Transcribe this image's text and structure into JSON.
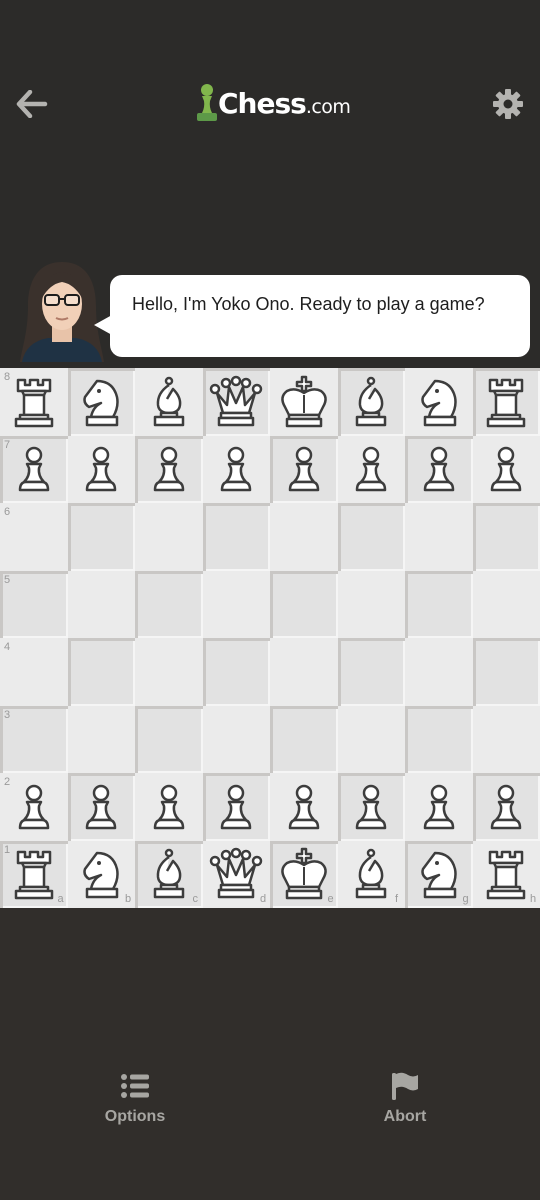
{
  "header": {
    "logo_text": "Chess",
    "logo_suffix": ".com",
    "back_icon": "arrow-left-icon",
    "settings_icon": "gear-icon"
  },
  "chat": {
    "message": "Hello, I'm Yoko Ono. Ready to play a game?"
  },
  "board": {
    "ranks": [
      "8",
      "7",
      "6",
      "5",
      "4",
      "3",
      "2",
      "1"
    ],
    "files": [
      "a",
      "b",
      "c",
      "d",
      "e",
      "f",
      "g",
      "h"
    ],
    "back_rank": [
      "rook",
      "knight",
      "bishop",
      "queen",
      "king",
      "bishop",
      "knight",
      "rook"
    ],
    "pawn_ranks": [
      "7",
      "2"
    ]
  },
  "bottom_nav": {
    "options_label": "Options",
    "abort_label": "Abort",
    "options_icon": "list-icon",
    "abort_icon": "flag-icon"
  },
  "colors": {
    "background": "#312e2b",
    "light_square": "#ebebeb",
    "dark_square": "#e2e2e2",
    "logo_pawn": "#81b64c"
  }
}
